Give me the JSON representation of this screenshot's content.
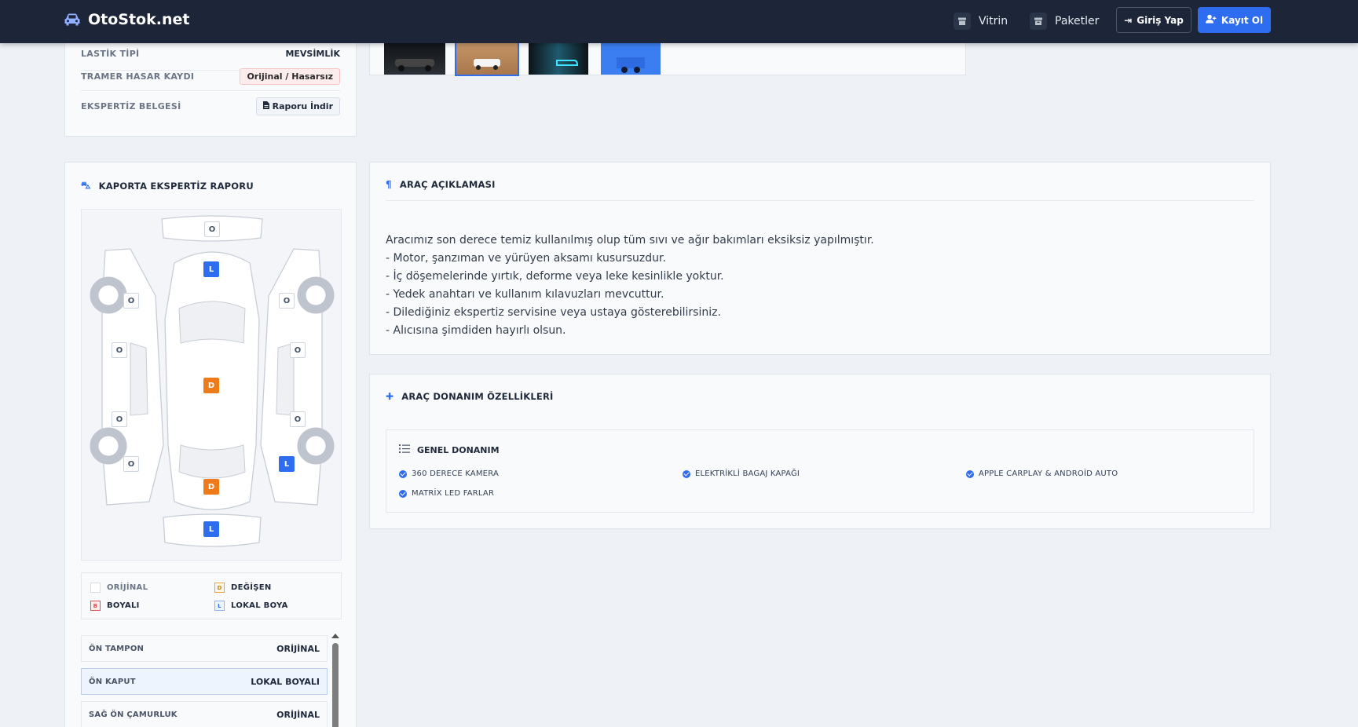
{
  "navbar": {
    "brand": "OtoStok.net",
    "links": [
      {
        "label": "Vitrin",
        "icon": "store-icon"
      },
      {
        "label": "Paketler",
        "icon": "box-icon"
      }
    ],
    "login_label": "Giriş Yap",
    "register_label": "Kayıt Ol"
  },
  "specs": [
    {
      "key": "LASTİK TİPİ",
      "value": "MEVSİMLİK"
    },
    {
      "key": "TRAMER HASAR KAYDI",
      "value": "Orijinal / Hasarsız"
    },
    {
      "key": "EKSPERTİZ BELGESİ",
      "value": "Raporu İndir"
    }
  ],
  "kaporta": {
    "title": "KAPORTA EKSPERTİZ RAPORU",
    "parts_on_diagram": {
      "rear_bumper": "O",
      "hood": "L",
      "left_front_fender": "O",
      "right_front_fender": "O",
      "left_front_door": "O",
      "right_front_door": "O",
      "roof": "D",
      "left_rear_door": "O",
      "right_rear_door": "O",
      "left_rear_fender": "O",
      "right_rear_fender": "L",
      "trunk": "D",
      "front_bumper": "L"
    },
    "legend": [
      {
        "code": "",
        "label": "ORİJİNAL",
        "color": "#cfd5dd"
      },
      {
        "code": "D",
        "label": "DEĞİŞEN",
        "color": "#e8a33a"
      },
      {
        "code": "B",
        "label": "BOYALI",
        "color": "#e05252"
      },
      {
        "code": "L",
        "label": "LOKAL BOYA",
        "color": "#2f6df0"
      }
    ],
    "list": [
      {
        "name": "ÖN TAMPON",
        "value": "ORİJİNAL"
      },
      {
        "name": "ÖN KAPUT",
        "value": "LOKAL BOYALI"
      },
      {
        "name": "SAĞ ÖN ÇAMURLUK",
        "value": "ORİJİNAL"
      }
    ]
  },
  "description": {
    "title": "ARAÇ AÇIKLAMASI",
    "lines": [
      "Aracımız son derece temiz kullanılmış olup tüm sıvı ve ağır bakımları eksiksiz yapılmıştır.",
      "- Motor, şanzıman ve yürüyen aksamı kusursuzdur.",
      "- İç döşemelerinde yırtık, deforme veya leke kesinlikle yoktur.",
      "- Yedek anahtarı ve kullanım kılavuzları mevcuttur.",
      "- Dilediğiniz ekspertiz servisine veya ustaya gösterebilirsiniz.",
      "- Alıcısına şimdiden hayırlı olsun."
    ]
  },
  "equipment": {
    "title": "ARAÇ DONANIM ÖZELLİKLERİ",
    "group_title": "GENEL DONANIM",
    "features": [
      "360 DERECE KAMERA",
      "ELEKTRİKLİ BAGAJ KAPAĞI",
      "APPLE CARPLAY & ANDROİD AUTO",
      "MATRİX LED FARLAR"
    ]
  },
  "colors": {
    "accent": "#2f6df0",
    "navbar": "#1c2638",
    "changed": "#ef7a1a"
  }
}
